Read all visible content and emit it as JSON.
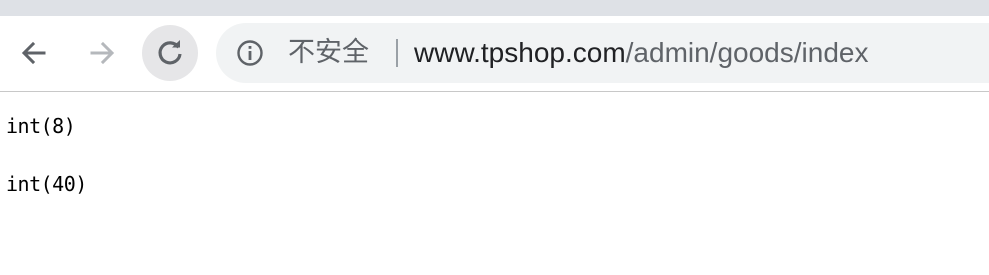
{
  "browser": {
    "security_label": "不安全",
    "url_host": "www.tpshop.com",
    "url_path": "/admin/goods/index",
    "icons": {
      "back": "arrow-left-icon",
      "forward": "arrow-right-icon",
      "reload": "reload-icon",
      "info": "info-circle-icon"
    },
    "colors": {
      "tabstrip": "#dee1e6",
      "omnibox": "#f1f3f4",
      "reload_highlight": "#e6e6e8"
    }
  },
  "page": {
    "lines": [
      "int(8)",
      "int(40)"
    ]
  }
}
